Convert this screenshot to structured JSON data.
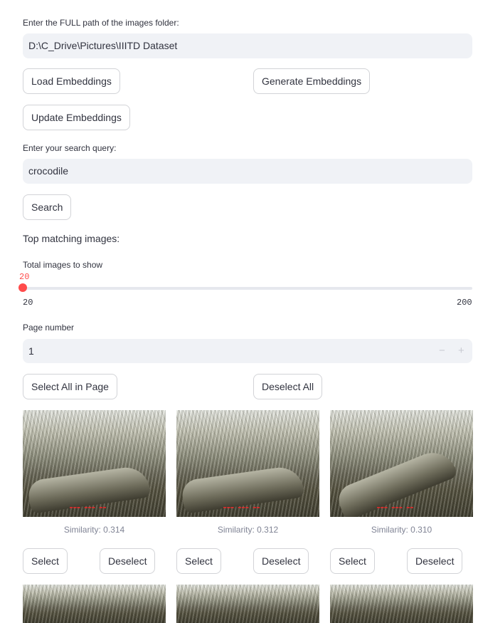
{
  "folder": {
    "label": "Enter the FULL path of the images folder:",
    "value": "D:\\C_Drive\\Pictures\\IIITD Dataset"
  },
  "buttons": {
    "load": "Load Embeddings",
    "generate": "Generate Embeddings",
    "update": "Update Embeddings",
    "search": "Search",
    "select_all": "Select All in Page",
    "deselect_all": "Deselect All"
  },
  "query": {
    "label": "Enter your search query:",
    "value": "crocodile"
  },
  "results_heading": "Top matching images:",
  "slider": {
    "label": "Total images to show",
    "value": "20",
    "min": "20",
    "max": "200"
  },
  "page": {
    "label": "Page number",
    "value": "1",
    "minus": "−",
    "plus": "+"
  },
  "cards": [
    {
      "similarity": "Similarity: 0.314",
      "select": "Select",
      "deselect": "Deselect"
    },
    {
      "similarity": "Similarity: 0.312",
      "select": "Select",
      "deselect": "Deselect"
    },
    {
      "similarity": "Similarity: 0.310",
      "select": "Select",
      "deselect": "Deselect"
    }
  ],
  "colors": {
    "accent": "#ff4b4b",
    "input_bg": "#f0f2f6",
    "text": "#31333f",
    "muted": "#808495"
  }
}
